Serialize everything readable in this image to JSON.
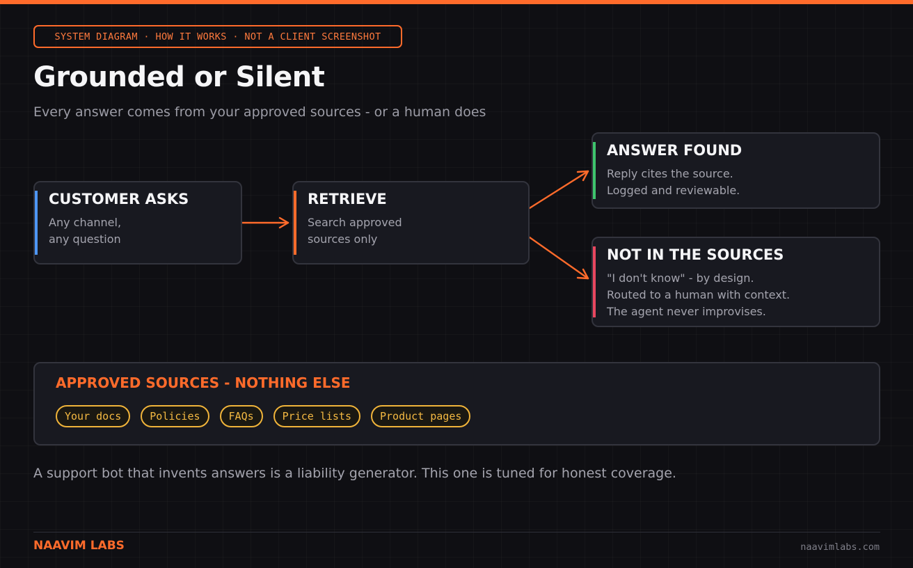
{
  "tag": "SYSTEM DIAGRAM · HOW IT WORKS · NOT A CLIENT SCREENSHOT",
  "title": "Grounded or Silent",
  "subtitle": "Every answer comes from your approved sources - or a human does",
  "nodes": [
    {
      "title": "CUSTOMER ASKS",
      "lines": [
        "Any channel,",
        "any question"
      ],
      "accent": "#4d96f5"
    },
    {
      "title": "RETRIEVE",
      "lines": [
        "Search approved",
        "sources only"
      ],
      "accent": "#ff6b2b"
    },
    {
      "title": "ANSWER FOUND",
      "lines": [
        "Reply cites the source.",
        "Logged and reviewable."
      ],
      "accent": "#3ec46d"
    },
    {
      "title": "NOT IN THE SOURCES",
      "lines": [
        "\"I don't know\" - by design.",
        "Routed to a human with context.",
        "The agent never improvises."
      ],
      "accent": "#e8475f"
    }
  ],
  "sources": {
    "title": "APPROVED SOURCES - NOTHING ELSE",
    "chips": [
      "Your docs",
      "Policies",
      "FAQs",
      "Price lists",
      "Product pages"
    ]
  },
  "footnote": "A support bot that invents answers is a liability generator. This one is tuned for honest coverage.",
  "footer": {
    "brand": "NAAVIM LABS",
    "url": "naavimlabs.com"
  },
  "colors": {
    "accent": "#ff6b2b",
    "chip": "#f0b43a",
    "background": "#0f0f13",
    "card": "#181920"
  }
}
